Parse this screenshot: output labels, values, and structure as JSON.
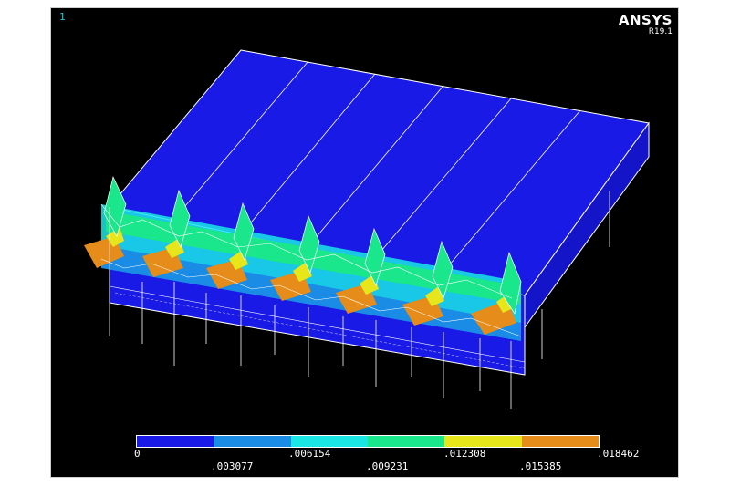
{
  "window": {
    "number": "1",
    "brand": "ANSYS",
    "release": "R19.1"
  },
  "colors": {
    "background": "#000000",
    "band1": "#1a1ae6",
    "band2": "#1a8ce6",
    "band3": "#1ae6e6",
    "band4": "#1ae68c",
    "band5": "#e6e61a",
    "band6": "#e68c1a",
    "mesh": "#ffffff"
  },
  "legend": {
    "bands": [
      "#1a1ae6",
      "#1a8ce6",
      "#1ae6e6",
      "#1ae68c",
      "#e6e61a",
      "#e68c1a"
    ],
    "top_labels": [
      "0",
      ".006154",
      ".012308",
      ".018462"
    ],
    "bottom_labels": [
      ".003077",
      ".009231",
      ".015385"
    ]
  }
}
